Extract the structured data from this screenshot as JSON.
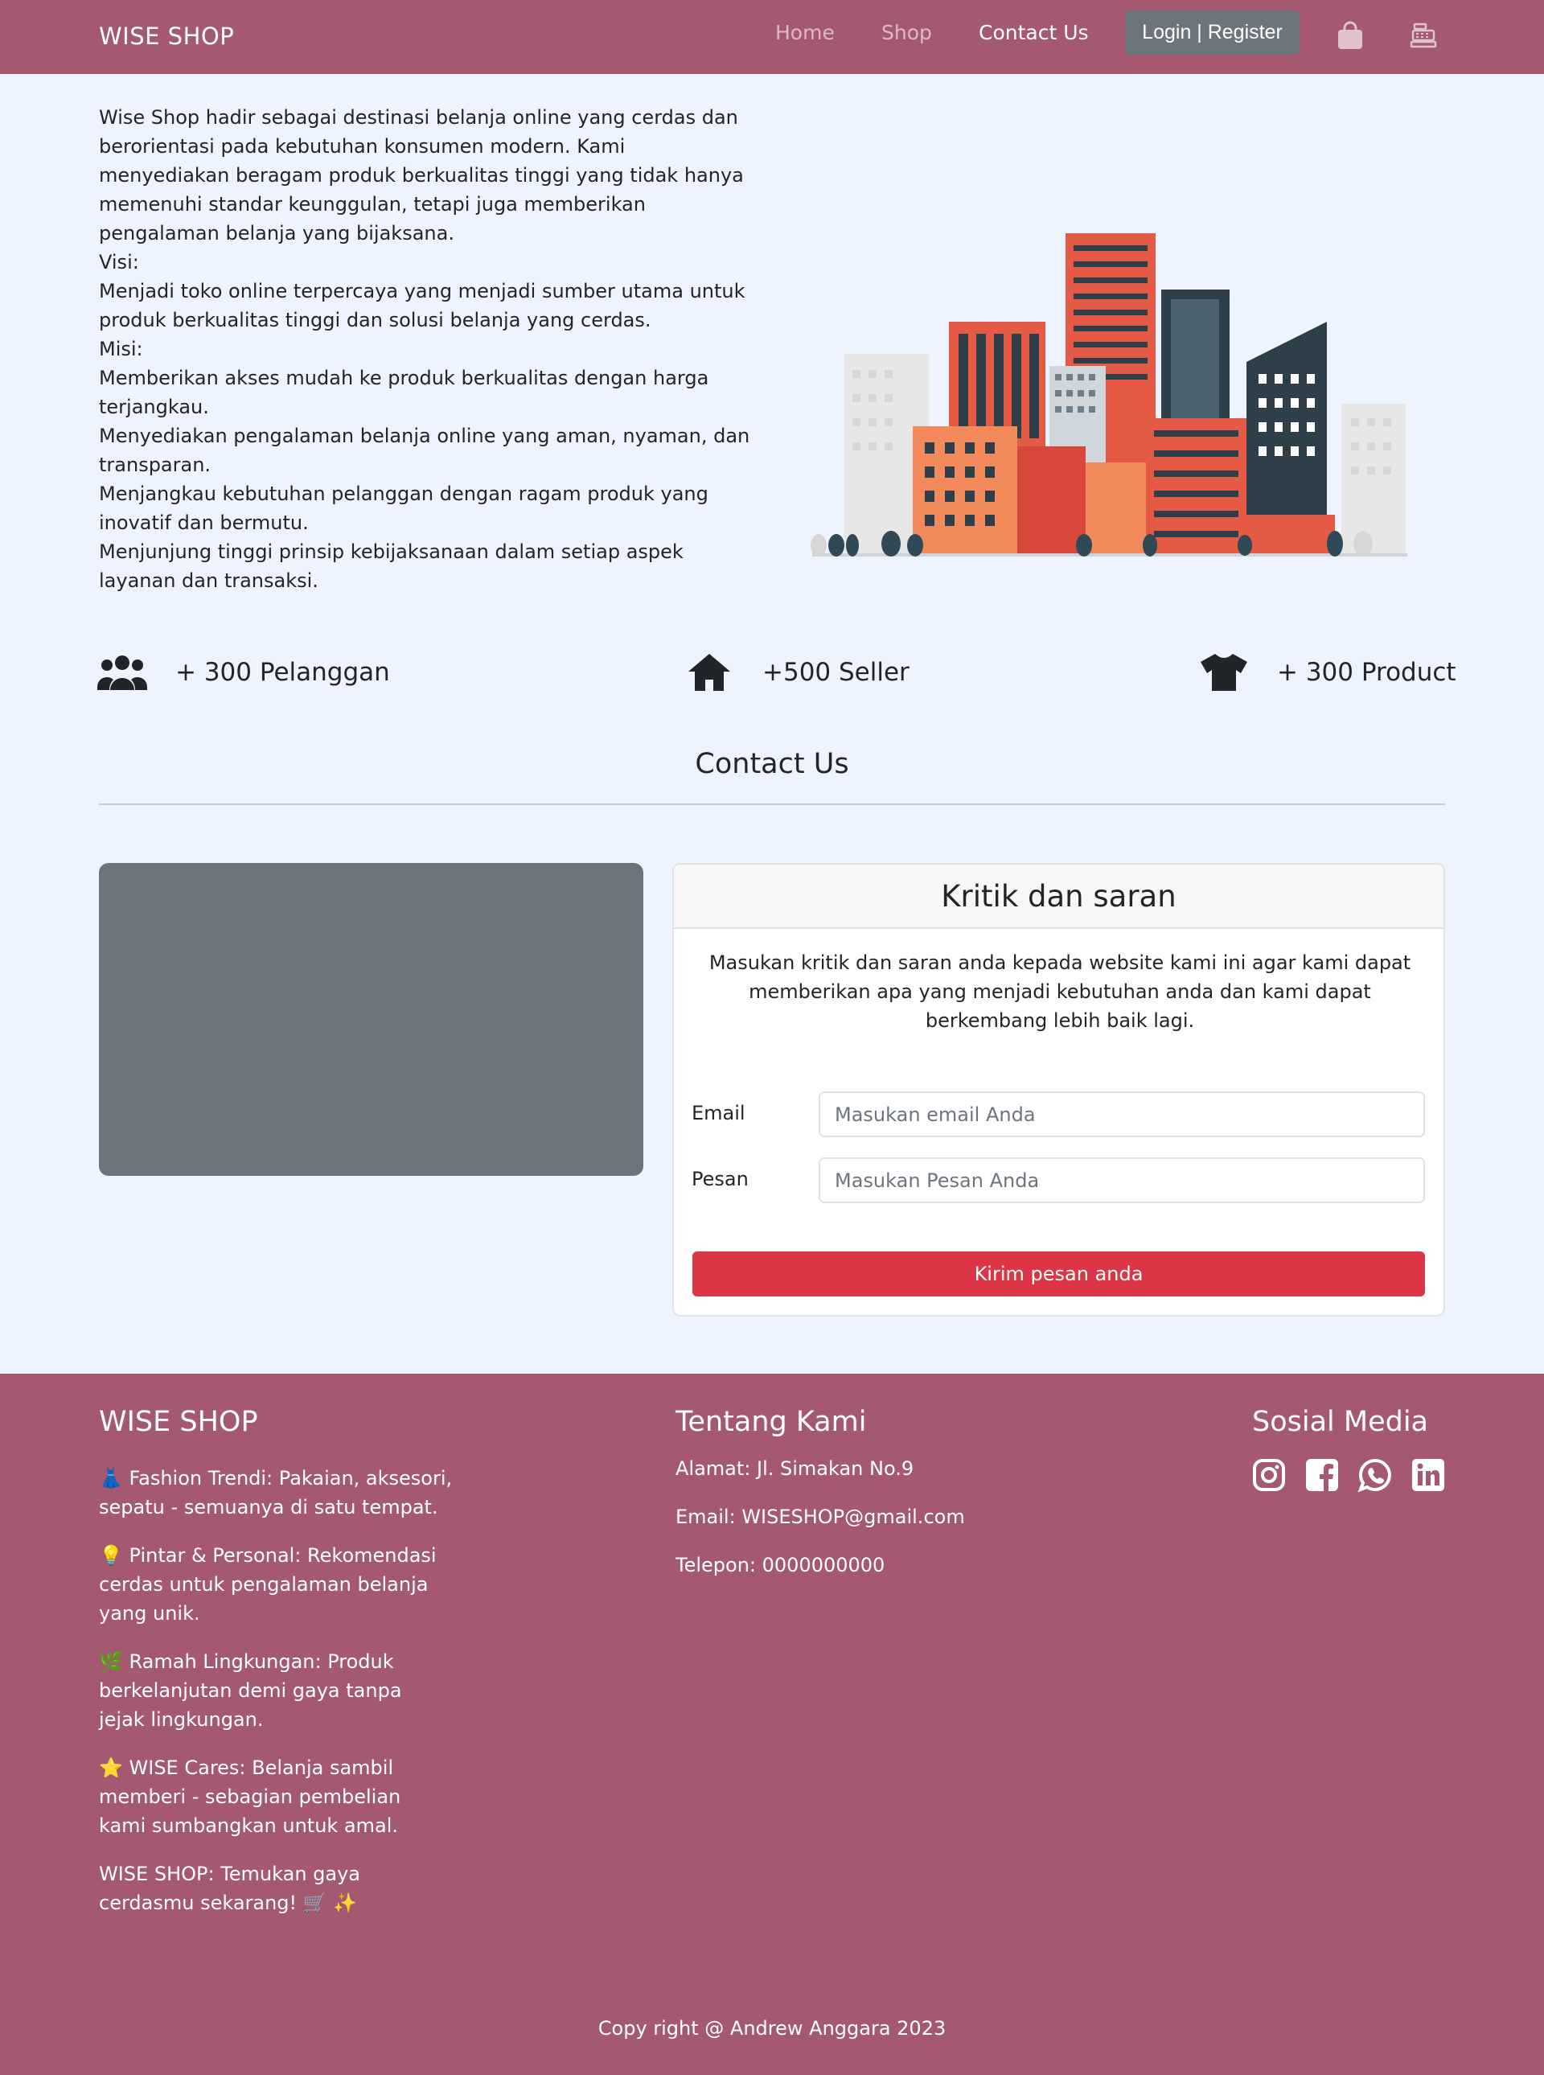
{
  "navbar": {
    "brand": "WISE SHOP",
    "links": [
      "Home",
      "Shop",
      "Contact Us"
    ],
    "active_link": "Contact Us",
    "login_label": "Login | Register",
    "icons": [
      "bag-icon",
      "cash-register-icon"
    ]
  },
  "about": {
    "paragraphs": [
      "Wise Shop hadir sebagai destinasi belanja online yang cerdas dan berorientasi pada kebutuhan konsumen modern. Kami menyediakan beragam produk berkualitas tinggi yang tidak hanya memenuhi standar keunggulan, tetapi juga memberikan pengalaman belanja yang bijaksana.",
      "Visi:",
      "Menjadi toko online terpercaya yang menjadi sumber utama untuk produk berkualitas tinggi dan solusi belanja yang cerdas.",
      "Misi:",
      "Memberikan akses mudah ke produk berkualitas dengan harga terjangkau.",
      "Menyediakan pengalaman belanja online yang aman, nyaman, dan transparan.",
      "Menjangkau kebutuhan pelanggan dengan ragam produk yang inovatif dan bermutu.",
      "Menjunjung tinggi prinsip kebijaksanaan dalam setiap aspek layanan dan transaksi."
    ]
  },
  "stats": [
    {
      "icon": "users-icon",
      "label": "+ 300 Pelanggan"
    },
    {
      "icon": "house-icon",
      "label": "+500 Seller"
    },
    {
      "icon": "shirt-icon",
      "label": "+ 300 Product"
    }
  ],
  "contact": {
    "title": "Contact Us",
    "card_title": "Kritik dan saran",
    "card_text": "Masukan kritik dan saran anda kepada website kami ini agar kami dapat memberikan apa yang menjadi kebutuhan anda dan kami dapat berkembang lebih baik lagi.",
    "email_label": "Email",
    "email_placeholder": "Masukan email Anda",
    "message_label": "Pesan",
    "message_placeholder": "Masukan Pesan Anda",
    "submit_label": "Kirim pesan anda"
  },
  "footer": {
    "brand_title": "WISE SHOP",
    "features": [
      "👗 Fashion Trendi: Pakaian, aksesori, sepatu - semuanya di satu tempat.",
      "💡 Pintar & Personal: Rekomendasi cerdas untuk pengalaman belanja yang unik.",
      "🌿 Ramah Lingkungan: Produk berkelanjutan demi gaya tanpa jejak lingkungan.",
      "⭐ WISE Cares: Belanja sambil memberi - sebagian pembelian kami sumbangkan untuk amal.",
      "WISE SHOP: Temukan gaya cerdasmu sekarang! 🛒 ✨"
    ],
    "about_title": "Tentang Kami",
    "address": "Alamat: Jl. Simakan No.9",
    "email": "Email: WISESHOP@gmail.com",
    "phone": "Telepon: 0000000000",
    "social_title": "Sosial Media",
    "social_icons": [
      "instagram-icon",
      "facebook-icon",
      "whatsapp-icon",
      "linkedin-icon"
    ],
    "copyright": "Copy right @ Andrew Anggara 2023"
  },
  "colors": {
    "navbar_bg": "#a45971",
    "page_bg": "#eef4ff",
    "login_bg": "#6c757d",
    "submit_bg": "#dc3545",
    "map_bg": "#6c757d"
  }
}
